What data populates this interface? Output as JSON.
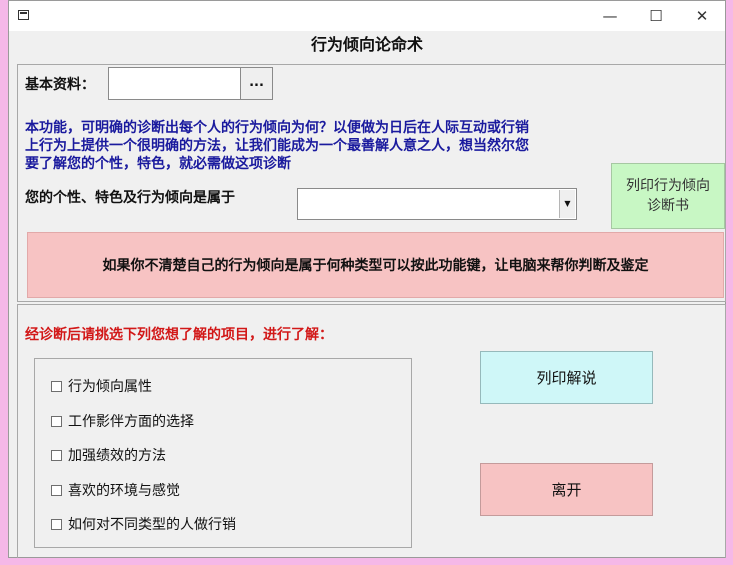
{
  "window": {
    "title": "行为倾向论命术",
    "controls": {
      "minimize": "—",
      "maximize": "☐",
      "close": "✕"
    }
  },
  "basic_info": {
    "label": "基本资料：",
    "value": "",
    "browse_label": "..."
  },
  "description": {
    "line1": "本功能，可明确的诊断出每个人的行为倾向为何？以便做为日后在人际互动或行销",
    "line2": "上行为上提供一个很明确的方法，让我们能成为一个最善解人意之人，想当然尔您",
    "line3": "要了解您的个性，特色，就必需做这项诊断"
  },
  "personality": {
    "label": "您的个性、特色及行为倾向是属于",
    "selected": ""
  },
  "buttons": {
    "print_report_line1": "列印行为倾向",
    "print_report_line2": "诊断书",
    "auto_diagnose": "如果你不清楚自己的行为倾向是属于何种类型可以按此功能键，让电脑来帮你判断及鉴定",
    "print_explain": "列印解说",
    "exit": "离开"
  },
  "selection_prompt": "经诊断后请挑选下列您想了解的项目，进行了解：",
  "options": [
    {
      "label": "行为倾向属性",
      "checked": false
    },
    {
      "label": "工作影伴方面的选择",
      "checked": false
    },
    {
      "label": "加强绩效的方法",
      "checked": false
    },
    {
      "label": "喜欢的环境与感觉",
      "checked": false
    },
    {
      "label": "如何对不同类型的人做行销",
      "checked": false
    }
  ],
  "colors": {
    "desktop": "#f5b8e8",
    "description_text": "#1a1a9e",
    "prompt_text": "#d21818",
    "report_button": "#c8f7c4",
    "auto_button": "#f7c3c3",
    "print_button": "#cff7f8",
    "exit_button": "#f7c3c3"
  }
}
